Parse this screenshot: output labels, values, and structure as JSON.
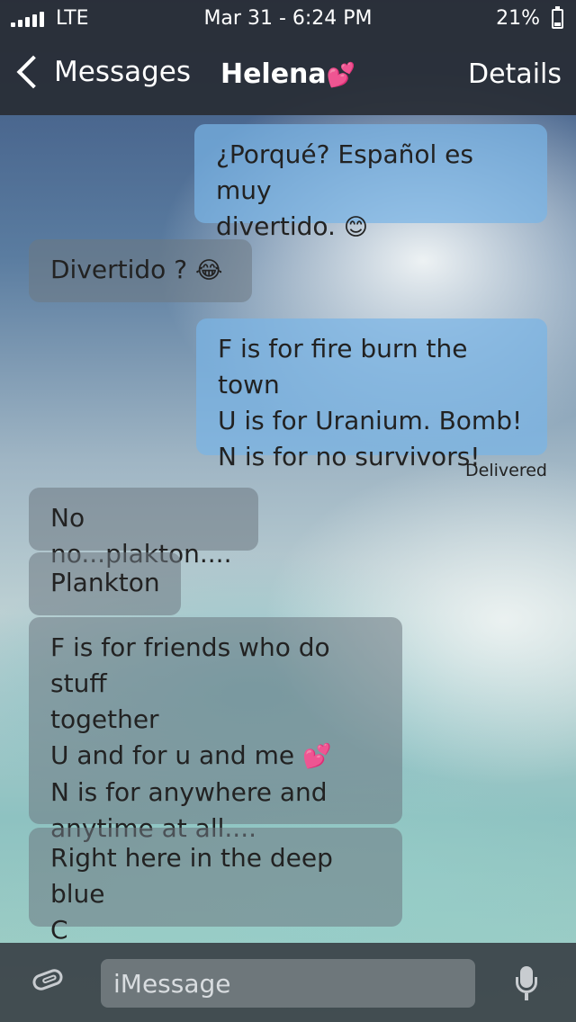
{
  "status": {
    "carrier": "LTE",
    "datetime": "Mar 31 - 6:24 PM",
    "battery_percent": "21%"
  },
  "nav": {
    "back_label": "Messages",
    "title": "Helena",
    "title_emoji": "💕",
    "details_label": "Details"
  },
  "messages": [
    {
      "direction": "out",
      "lines": [
        "¿Porqué? Español es muy",
        "divertido."
      ],
      "emoji": "😊"
    },
    {
      "direction": "in",
      "lines": [
        "Divertido ?"
      ],
      "emoji": "😂"
    },
    {
      "direction": "out",
      "lines": [
        "F is for fire burn the town",
        "U is for Uranium. Bomb!",
        "N is for no survivors!"
      ]
    },
    {
      "direction": "in",
      "lines": [
        "No no...plakton...."
      ]
    },
    {
      "direction": "in",
      "lines": [
        "Plankton"
      ]
    },
    {
      "direction": "in",
      "lines": [
        "F is for friends who do stuff",
        "together",
        "U and for u and me",
        "N is for anywhere and",
        "anytime at all...."
      ],
      "emoji": "💕"
    },
    {
      "direction": "in",
      "lines": [
        "Right here in the deep blue",
        "C"
      ]
    }
  ],
  "delivered_label": "Delivered",
  "compose": {
    "placeholder": "iMessage"
  }
}
